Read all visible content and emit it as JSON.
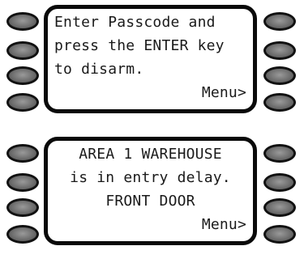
{
  "panels": [
    {
      "lines": [
        "Enter Passcode and",
        "press the ENTER key",
        "to disarm.",
        "Menu>"
      ]
    },
    {
      "lines": [
        "AREA 1 WAREHOUSE",
        "is in entry delay.",
        "FRONT DOOR",
        "Menu>"
      ]
    }
  ],
  "colors": {
    "bezel": "#0a0a0a",
    "button_fill": "#6e6e6e",
    "text": "#1a1a1a"
  }
}
